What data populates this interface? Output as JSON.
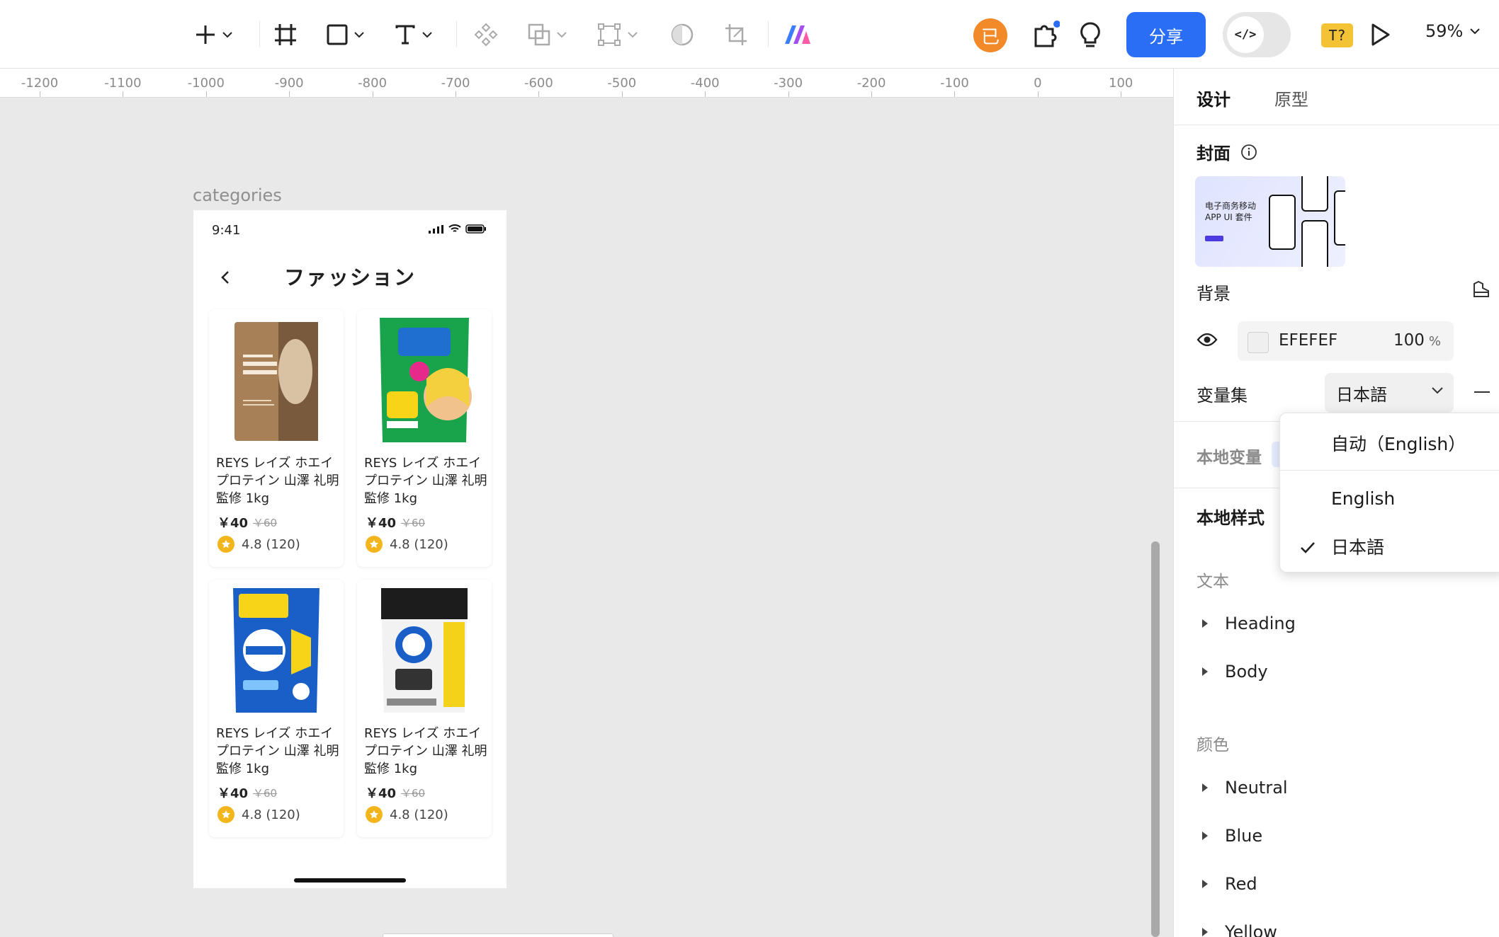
{
  "toolbar": {
    "avatar_initial": "已",
    "share_label": "分享",
    "dev_mode_label": "</>",
    "translate_badge": "T?",
    "zoom_label": "59%"
  },
  "ruler": {
    "ticks": [
      "-1200",
      "-1100",
      "-1000",
      "-900",
      "-800",
      "-700",
      "-600",
      "-500",
      "-400",
      "-300",
      "-200",
      "-100",
      "0",
      "100"
    ]
  },
  "canvas": {
    "frame_label": "categories",
    "phone": {
      "status_time": "9:41",
      "title": "ファッション",
      "products": [
        {
          "name": "REYS レイズ ホエイ プロテイン 山澤 礼明 監修 1kg",
          "price": "￥40",
          "old_price": "￥60",
          "rating": "4.8 (120)",
          "image": "protein-bag"
        },
        {
          "name": "REYS レイズ ホエイ プロテイン 山澤 礼明 監修 1kg",
          "price": "￥40",
          "old_price": "￥60",
          "rating": "4.8 (120)",
          "image": "detergent-green"
        },
        {
          "name": "REYS レイズ ホエイ プロテイン 山澤 礼明 監修 1kg",
          "price": "￥40",
          "old_price": "￥60",
          "rating": "4.8 (120)",
          "image": "detergent-blue"
        },
        {
          "name": "REYS レイズ ホエイ プロテイン 山澤 礼明 監修 1kg",
          "price": "￥40",
          "old_price": "￥60",
          "rating": "4.8 (120)",
          "image": "detergent-black"
        }
      ]
    }
  },
  "panel": {
    "tabs": {
      "design": "设计",
      "prototype": "原型"
    },
    "cover": {
      "title": "封面",
      "thumb_text": "电子商务移动\nAPP UI 套件"
    },
    "background": {
      "title": "背景",
      "hex": "EFEFEF",
      "opacity": "100",
      "opacity_unit": "%",
      "color": "#EFEFEF"
    },
    "variables": {
      "title": "变量集",
      "selected": "日本語"
    },
    "local_variables": {
      "title": "本地变量"
    },
    "local_styles": {
      "title": "本地样式",
      "text_section": "文本",
      "text_items": [
        "Heading",
        "Body"
      ],
      "color_section": "颜色",
      "color_items": [
        "Neutral",
        "Blue",
        "Red",
        "Yellow"
      ]
    }
  },
  "dropdown": {
    "options": [
      "自动（English）",
      "English",
      "日本語"
    ],
    "checked": "日本語"
  },
  "colors": {
    "accent": "#2A6EF5",
    "avatar": "#F28A2A",
    "star": "#F3B51C"
  }
}
